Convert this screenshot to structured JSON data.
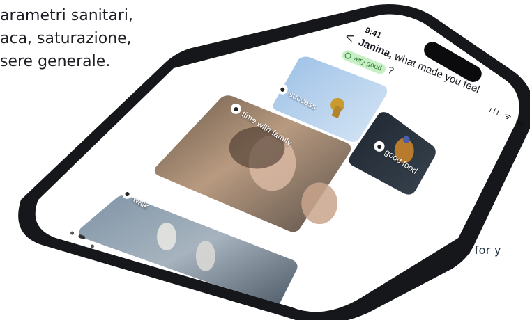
{
  "intro": {
    "lines": [
      "arametri sanitari,",
      "aca, saturazione,",
      "sere generale."
    ]
  },
  "caption": "Hitech for y",
  "phone": {
    "status_time": "9:41",
    "status_icons": "ıll ᯤ ▬",
    "back_glyph": "<",
    "question": {
      "name": "Janina,",
      "text": " what made you feel",
      "mood_badge": "very good",
      "mark": "?"
    },
    "cards": [
      {
        "id": "success",
        "label": "success"
      },
      {
        "id": "time-with-family",
        "label": "time with family"
      },
      {
        "id": "good-food",
        "label": "good food"
      },
      {
        "id": "walk",
        "label": "walk"
      }
    ]
  },
  "colors": {
    "frame": "#16171a",
    "screen": "#ffffff",
    "badge_bg": "#c8efc6",
    "badge_fg": "#2d7a2d",
    "callout": "#4d5560"
  }
}
